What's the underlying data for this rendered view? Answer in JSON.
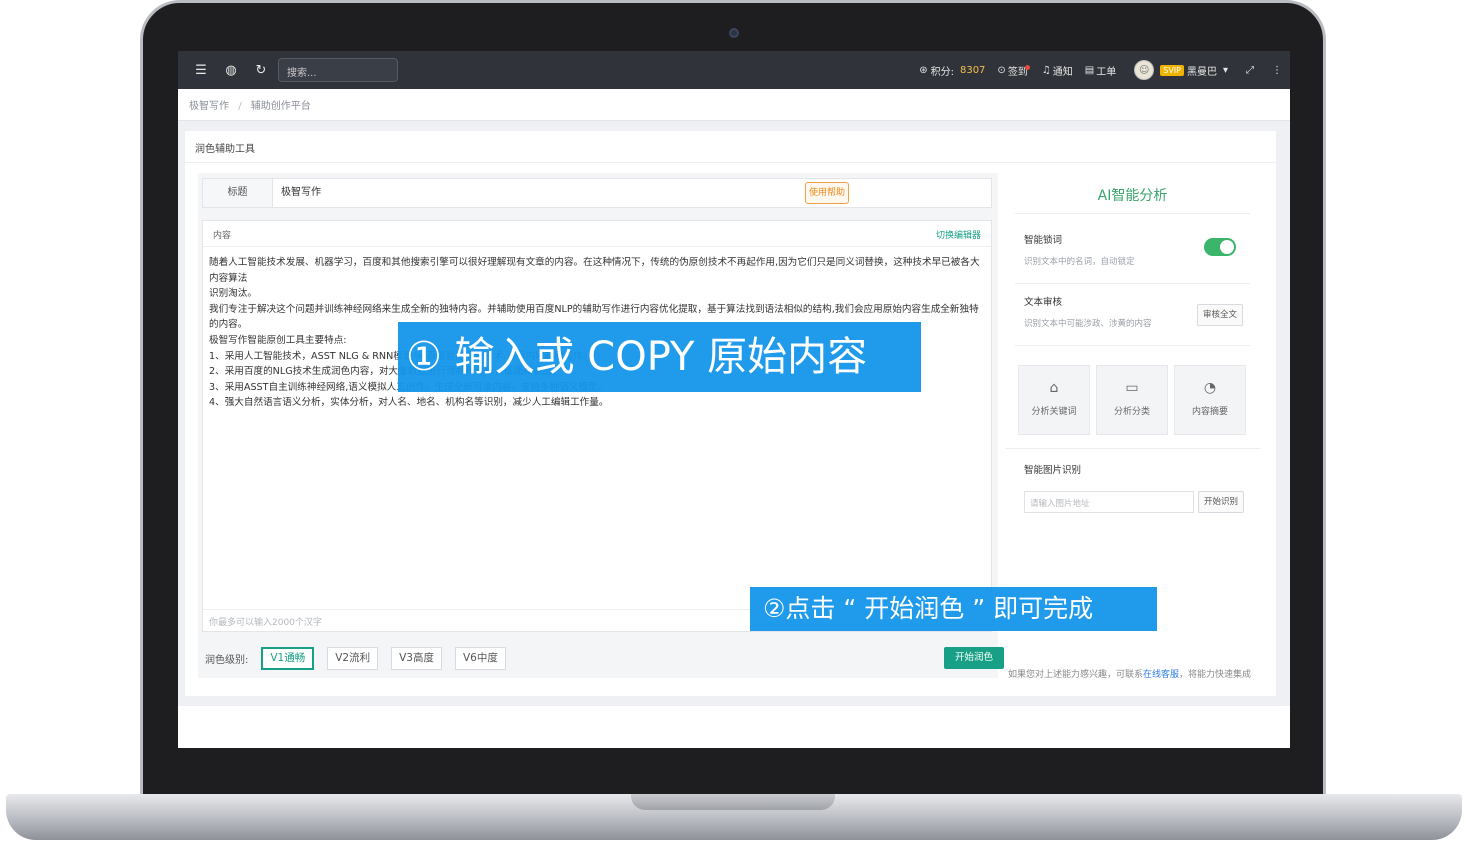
{
  "topbar": {
    "search_placeholder": "搜索...",
    "points_label": "积分:",
    "points_value": "8307",
    "checkin": "签到",
    "notify": "通知",
    "ticket": "工单",
    "vip_badge": "SVIP",
    "username": "黑曼巴"
  },
  "breadcrumb": [
    "极智写作",
    "辅助创作平台"
  ],
  "card": {
    "title": "润色辅助工具"
  },
  "editor": {
    "title_label": "标题",
    "title_value": "极智写作",
    "help_button": "使用帮助",
    "content_label": "内容",
    "switch_editor": "切换编辑器",
    "content_lines": [
      "随着人工智能技术发展、机器学习，百度和其他搜索引擎可以很好理解现有文章的内容。在这种情况下，传统的伪原创技术不再起作用,因为它们只是同义词替换，这种技术早已被各大内容算法",
      "识别淘汰。",
      "我们专注于解决这个问题并训练神经网络来生成全新的独特内容。并辅助使用百度NLP的辅助写作进行内容优化提取，基于算法找到语法相似的结构,我们会应用原始内容生成全新独特的内容。",
      "极智写作智能原创工具主要特点:",
      "1、采用人工智能技术，ASST NLG & RNN模型 + 百度智能写作技术,进行内容辅助写作。",
      "2、采用百度的NLG技术生成润色内容，对大量数据进行理解和分析，推理和重组。",
      "3、采用ASST自主训练神经网络,语义模拟人工创作，生成全新可读内容，支持多种语义模型。",
      "4、强大自然语言语义分析，实体分析，对人名、地名、机构名等识别，减少人工编辑工作量。"
    ],
    "footer_hint": "你最多可以输入2000个汉字",
    "level_label": "润色级别:",
    "levels": [
      "V1通畅",
      "V2流利",
      "V3高度",
      "V6中度"
    ],
    "start_button": "开始润色"
  },
  "ai_panel": {
    "title": "AI智能分析",
    "smart_lock": {
      "title": "智能锁词",
      "desc": "识别文本中的名词，自动锁定",
      "enabled": true
    },
    "text_audit": {
      "title": "文本审核",
      "desc": "识别文本中可能涉政、涉黄的内容",
      "button": "审核全文"
    },
    "tiles": [
      {
        "icon": "tag-icon",
        "label": "分析关键词"
      },
      {
        "icon": "document-icon",
        "label": "分析分类"
      },
      {
        "icon": "palette-icon",
        "label": "内容摘要"
      }
    ],
    "image_recognition": {
      "title": "智能图片识别",
      "placeholder": "请输入图片地址",
      "button": "开始识别"
    },
    "footnote_prefix": "如果您对上述能力感兴趣，可联系",
    "footnote_link": "在线客服",
    "footnote_suffix": "，将能力快速集成"
  },
  "overlays": {
    "step1": "① 输入或 COPY 原始内容",
    "step2": "②点击  “ 开始润色 ”  即可完成"
  },
  "colors": {
    "accent": "#17a085",
    "topbar": "#30333a",
    "overlay": "#1496eb",
    "ai_title": "#3aa56d"
  }
}
